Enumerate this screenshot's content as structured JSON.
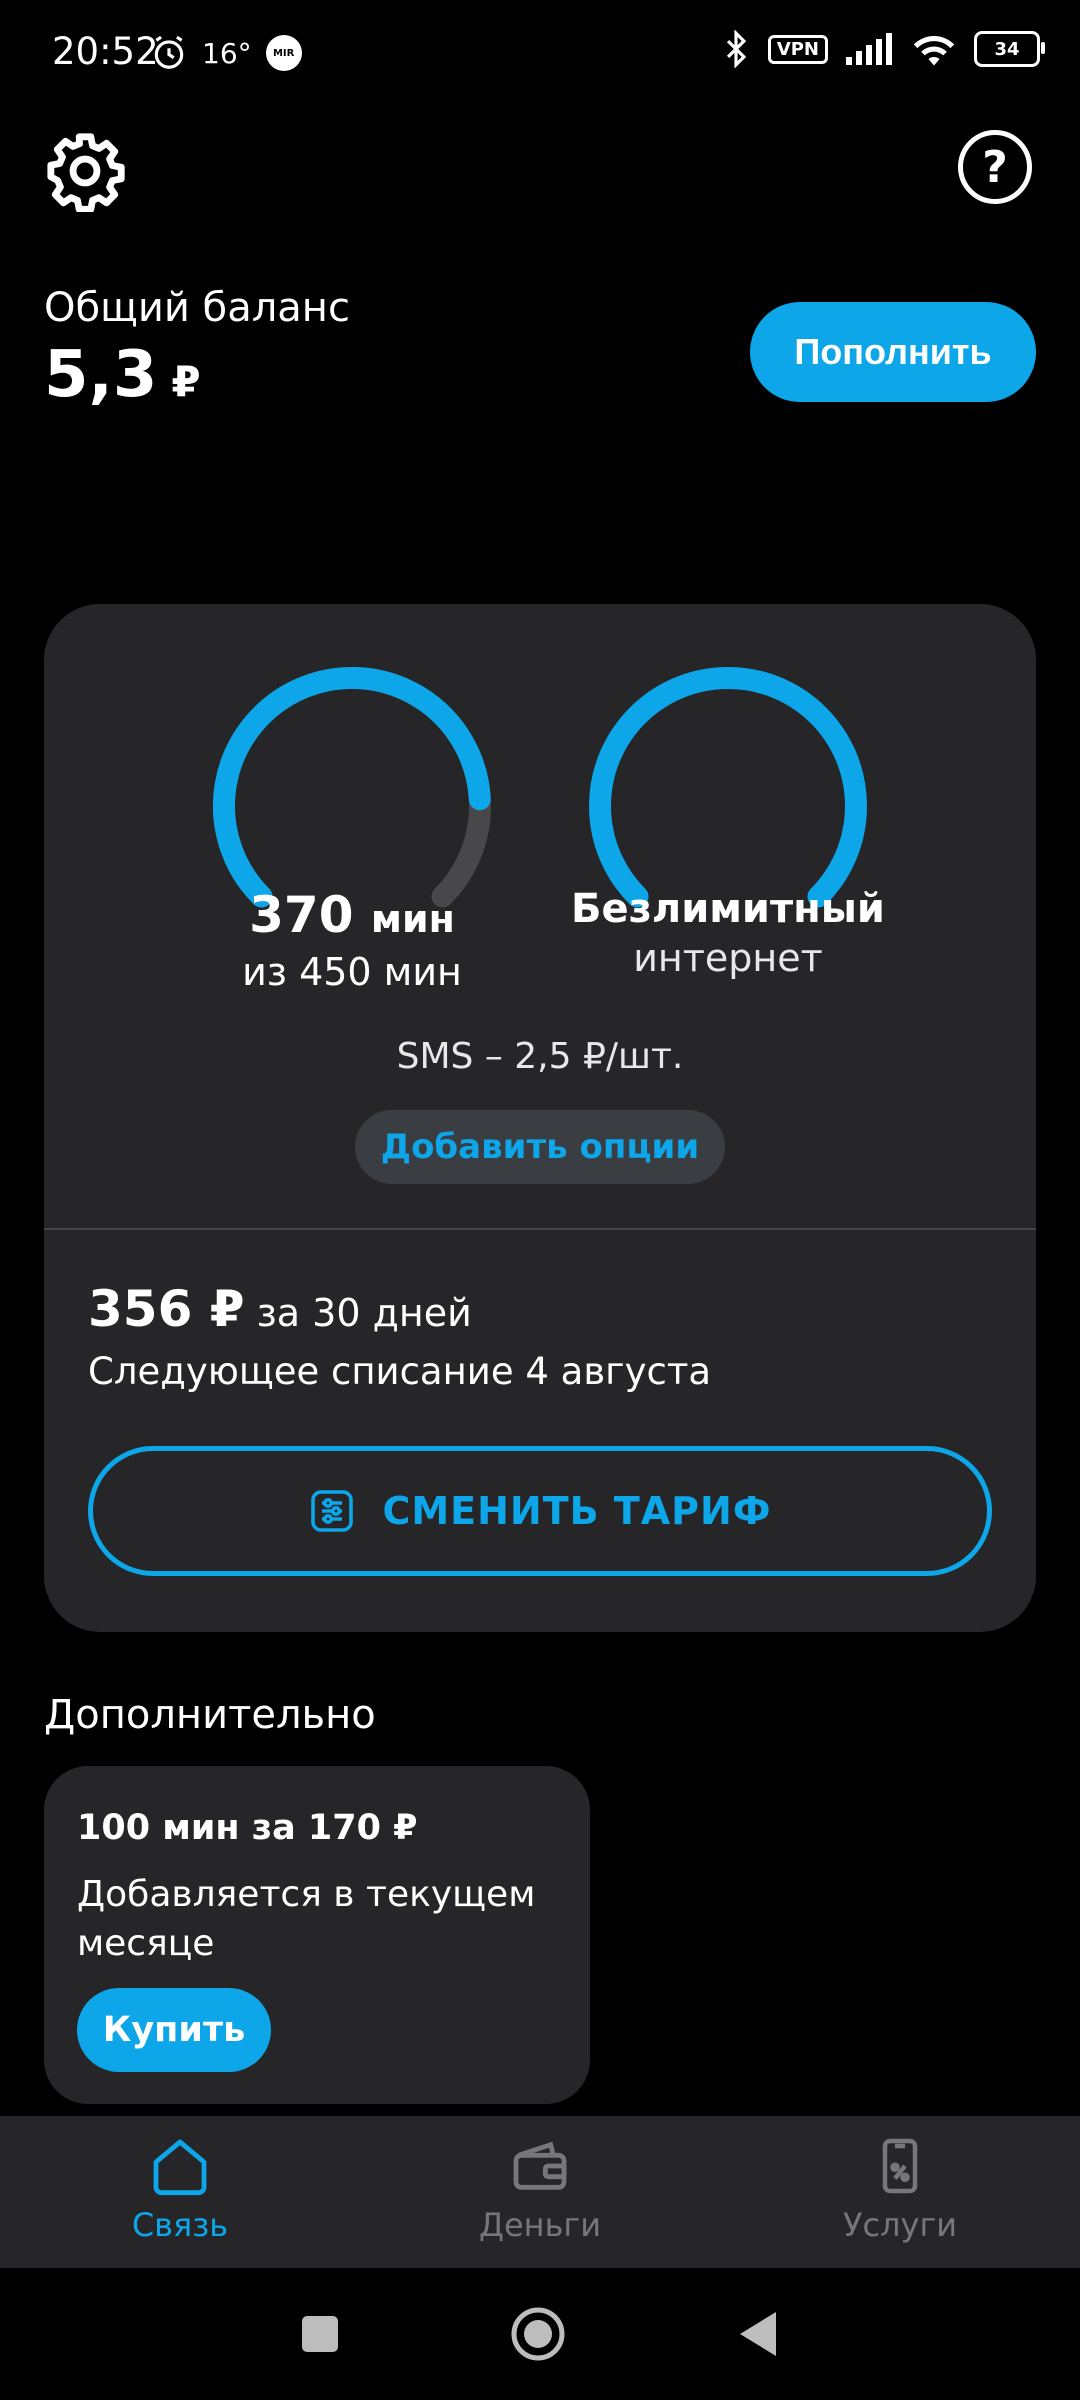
{
  "status_bar": {
    "time": "20:52",
    "temperature": "16°",
    "mir": "MIR",
    "vpn": "VPN",
    "battery": "34"
  },
  "header": {
    "balance_label": "Общий баланс",
    "balance_value": "5,3",
    "currency": "₽",
    "topup_label": "Пополнить"
  },
  "tariff_card": {
    "minutes_left": "370",
    "minutes_unit": "мин",
    "minutes_total": "из 450 мин",
    "minutes_fraction_left": 0.822,
    "internet_title": "Безлимитный",
    "internet_sub": "интернет",
    "sms_text": "SMS – 2,5 ₽/шт.",
    "add_options_label": "Добавить опции",
    "price": "356 ₽",
    "period": "за 30 дней",
    "next_charge": "Следующее списание 4 августа",
    "change_tariff_label": "СМЕНИТЬ ТАРИФ"
  },
  "extra": {
    "title": "Дополнительно",
    "offer_title": "100 мин за 170 ₽",
    "offer_desc": "Добавляется в текущем месяце",
    "buy_label": "Купить"
  },
  "bottom_nav": [
    {
      "label": "Связь",
      "icon": "home-icon",
      "active": true
    },
    {
      "label": "Деньги",
      "icon": "wallet-icon",
      "active": false
    },
    {
      "label": "Услуги",
      "icon": "phone-percent-icon",
      "active": false
    }
  ],
  "colors": {
    "accent": "#0ca6e9",
    "card": "#262628",
    "track": "#48484b"
  }
}
